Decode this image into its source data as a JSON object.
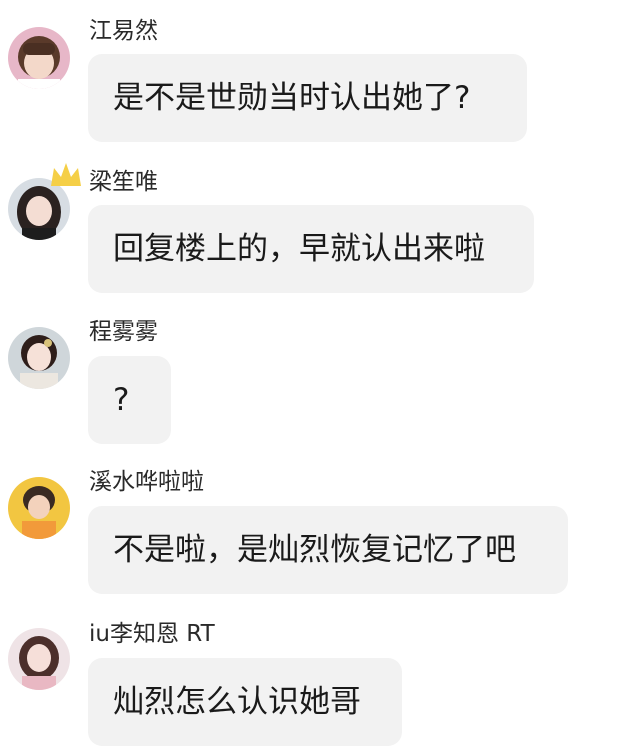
{
  "comments": [
    {
      "username": "江易然",
      "text": "是不是世勋当时认出她了?",
      "avatar_icon": "user-avatar-icon",
      "has_crown": false
    },
    {
      "username": "梁笙唯",
      "text": "回复楼上的，早就认出来啦",
      "avatar_icon": "user-avatar-icon",
      "has_crown": true,
      "crown_icon": "crown-icon"
    },
    {
      "username": "程雾雾",
      "text": "?",
      "avatar_icon": "user-avatar-icon",
      "has_crown": false
    },
    {
      "username": "溪水哗啦啦",
      "text": "不是啦，是灿烈恢复记忆了吧",
      "avatar_icon": "user-avatar-icon",
      "has_crown": false
    },
    {
      "username": "iu李知恩 RT",
      "text": "灿烈怎么认识她哥",
      "avatar_icon": "user-avatar-icon",
      "has_crown": false
    }
  ],
  "colors": {
    "background": "#ffffff",
    "bubble": "#f2f2f2",
    "crown": "#f5cf47"
  }
}
